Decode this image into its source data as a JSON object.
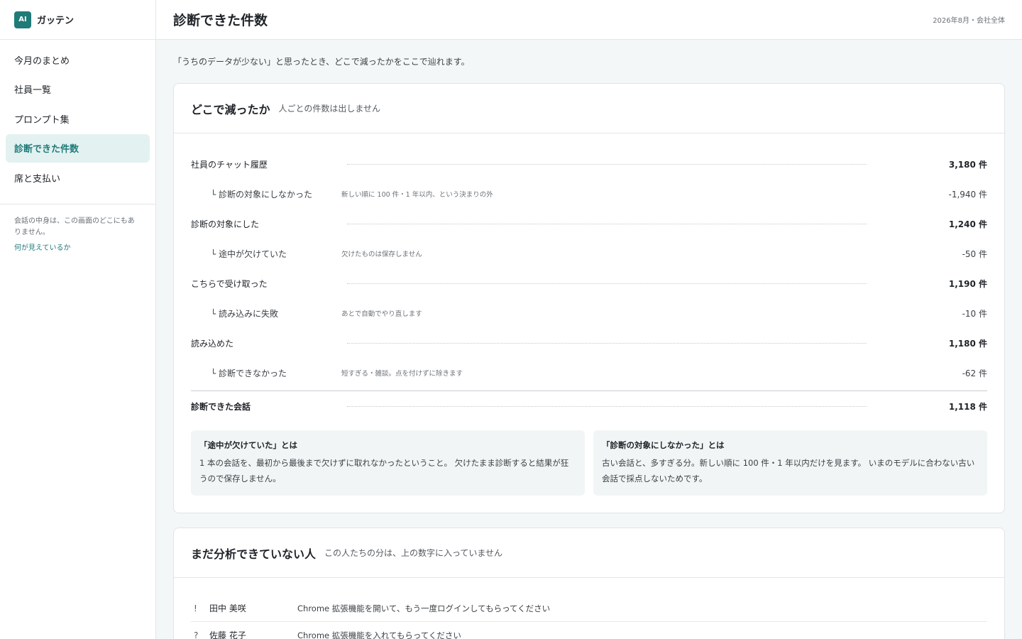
{
  "brand": {
    "logo": "AI",
    "name": "ガッテン"
  },
  "nav": [
    {
      "label": "今月のまとめ",
      "active": false
    },
    {
      "label": "社員一覧",
      "active": false
    },
    {
      "label": "プロンプト集",
      "active": false
    },
    {
      "label": "診断できた件数",
      "active": true
    },
    {
      "label": "席と支払い",
      "active": false
    }
  ],
  "side_note": {
    "text": "会話の中身は、この画面のどこにもありません。",
    "link": "何が見えているか"
  },
  "header": {
    "title": "診断できた件数",
    "context": "2026年8月・会社全体"
  },
  "intro": "「うちのデータが少ない」と思ったとき、どこで減ったかをここで辿れます。",
  "funnel": {
    "title": "どこで減ったか",
    "subtitle": "人ごとの件数は出しません",
    "rows": [
      {
        "label": "社員のチャット履歴",
        "value": "3,180 件"
      },
      {
        "label": "└ 診断の対象にしなかった",
        "note": "新しい順に 100 件・1 年以内、という決まりの外",
        "value": "-1,940 件"
      },
      {
        "label": "診断の対象にした",
        "value": "1,240 件"
      },
      {
        "label": "└ 途中が欠けていた",
        "note": "欠けたものは保存しません",
        "value": "-50 件"
      },
      {
        "label": "こちらで受け取った",
        "value": "1,190 件"
      },
      {
        "label": "└ 読み込みに失敗",
        "note": "あとで自動でやり直します",
        "value": "-10 件"
      },
      {
        "label": "読み込めた",
        "value": "1,180 件"
      },
      {
        "label": "└ 診断できなかった",
        "note": "短すぎる・雑談。点を付けずに除きます",
        "value": "-62 件"
      }
    ],
    "total": {
      "label": "診断できた会話",
      "value": "1,118 件"
    },
    "definitions": [
      {
        "title": "「途中が欠けていた」とは",
        "text": "1 本の会話を、最初から最後まで欠けずに取れなかったということ。 欠けたまま診断すると結果が狂うので保存しません。"
      },
      {
        "title": "「診断の対象にしなかった」とは",
        "text": "古い会話と、多すぎる分。新しい順に 100 件・1 年以内だけを見ます。 いまのモデルに合わない古い会話で採点しないためです。"
      }
    ]
  },
  "pending": {
    "title": "まだ分析できていない人",
    "subtitle": "この人たちの分は、上の数字に入っていません",
    "rows": [
      {
        "flag": "!",
        "name": "田中 美咲",
        "message": "Chrome 拡張機能を開いて、もう一度ログインしてもらってください"
      },
      {
        "flag": "?",
        "name": "佐藤 花子",
        "message": "Chrome 拡張機能を入れてもらってください"
      }
    ]
  }
}
